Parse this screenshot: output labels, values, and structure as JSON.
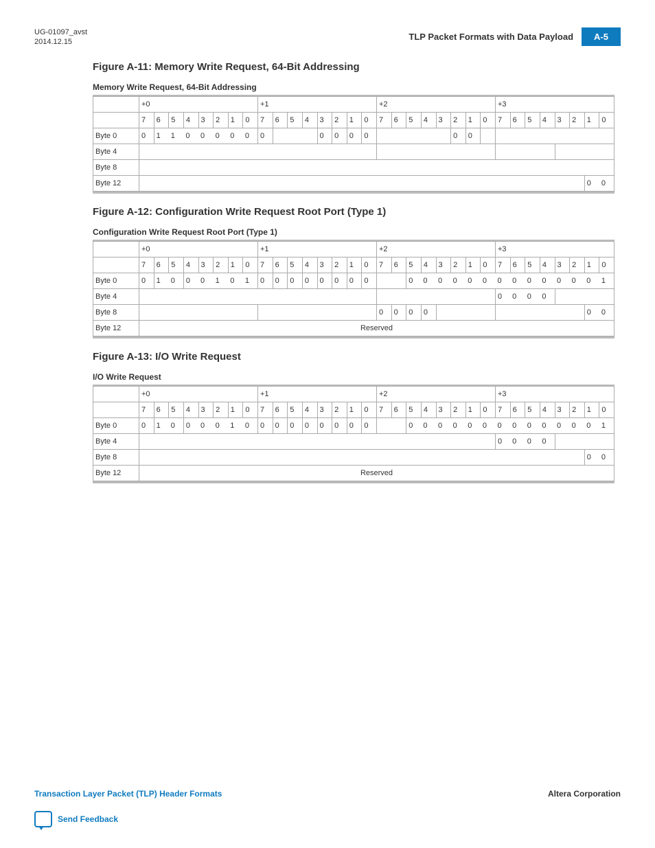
{
  "header": {
    "doc_id": "UG-01097_avst",
    "date": "2014.12.15",
    "title": "TLP Packet Formats with Data Payload",
    "page_tag": "A-5"
  },
  "figures": [
    {
      "title": "Figure A-11: Memory Write Request, 64-Bit Addressing",
      "caption": "Memory Write Request, 64-Bit Addressing"
    },
    {
      "title": "Figure A-12: Configuration Write Request Root Port (Type 1)",
      "caption": "Configuration Write Request Root Port (Type 1)"
    },
    {
      "title": "Figure A-13: I/O Write Request",
      "caption": "I/O Write Request"
    }
  ],
  "offsets": [
    "+0",
    "+1",
    "+2",
    "+3"
  ],
  "bits": [
    "7",
    "6",
    "5",
    "4",
    "3",
    "2",
    "1",
    "0"
  ],
  "row_labels": [
    "Byte 0",
    "Byte 4",
    "Byte 8",
    "Byte 12"
  ],
  "reserved": "Reserved",
  "chart_data": {
    "type": "table",
    "description": "TLP header byte layouts, 4 DW rows × 32 bit columns, grouped into +0..+3",
    "tables": [
      {
        "name": "Memory Write Request 64-Bit Addressing",
        "columns_groups": [
          "+0",
          "+1",
          "+2",
          "+3"
        ],
        "bit_labels_per_group": [
          7,
          6,
          5,
          4,
          3,
          2,
          1,
          0
        ],
        "rows": {
          "Byte 0": {
            "+0": [
              "0",
              "1",
              "1",
              "0",
              "0",
              "0",
              "0",
              "0"
            ],
            "+1": [
              "0",
              "",
              "",
              "",
              "0",
              "0",
              "0",
              "0"
            ],
            "+2": [
              "",
              "",
              "",
              "",
              "",
              "0",
              "0",
              ""
            ],
            "+3": [
              "",
              "",
              "",
              "",
              "",
              "",
              "",
              ""
            ]
          },
          "Byte 4": {
            "+0": [],
            "+1": [],
            "+2": [],
            "+3": []
          },
          "Byte 8": {
            "+0": [],
            "+1": [],
            "+2": [],
            "+3": []
          },
          "Byte 12": {
            "+0": [],
            "+1": [],
            "+2": [],
            "+3": [
              "",
              "",
              "",
              "",
              "",
              "",
              "0",
              "0"
            ]
          }
        }
      },
      {
        "name": "Configuration Write Request Root Port (Type 1)",
        "rows": {
          "Byte 0": {
            "+0": [
              "0",
              "1",
              "0",
              "0",
              "0",
              "1",
              "0",
              "1"
            ],
            "+1": [
              "0",
              "0",
              "0",
              "0",
              "0",
              "0",
              "0",
              "0"
            ],
            "+2": [
              "",
              "",
              "0",
              "0",
              "0",
              "0",
              "0",
              "0"
            ],
            "+3": [
              "0",
              "0",
              "0",
              "0",
              "0",
              "0",
              "0",
              "1"
            ]
          },
          "Byte 4": {
            "+0": [],
            "+1": [],
            "+2": [],
            "+3": [
              "0",
              "0",
              "0",
              "0",
              "",
              "",
              "",
              ""
            ]
          },
          "Byte 8": {
            "+0": [],
            "+1": [],
            "+2": [
              "0",
              "0",
              "0",
              "0",
              "",
              "",
              "",
              ""
            ],
            "+3": [
              "",
              "",
              "",
              "",
              "",
              "",
              "0",
              "0"
            ]
          },
          "Byte 12": {
            "span": "Reserved"
          }
        }
      },
      {
        "name": "I/O Write Request",
        "rows": {
          "Byte 0": {
            "+0": [
              "0",
              "1",
              "0",
              "0",
              "0",
              "0",
              "1",
              "0"
            ],
            "+1": [
              "0",
              "0",
              "0",
              "0",
              "0",
              "0",
              "0",
              "0"
            ],
            "+2": [
              "",
              "",
              "0",
              "0",
              "0",
              "0",
              "0",
              "0"
            ],
            "+3": [
              "0",
              "0",
              "0",
              "0",
              "0",
              "0",
              "0",
              "1"
            ]
          },
          "Byte 4": {
            "+0": [],
            "+1": [],
            "+2": [],
            "+3": [
              "0",
              "0",
              "0",
              "0",
              "",
              "",
              "",
              ""
            ]
          },
          "Byte 8": {
            "+0": [],
            "+1": [],
            "+2": [],
            "+3": [
              "",
              "",
              "",
              "",
              "",
              "",
              "0",
              "0"
            ]
          },
          "Byte 12": {
            "span": "Reserved"
          }
        }
      }
    ]
  },
  "footer": {
    "left_link": "Transaction Layer Packet (TLP) Header Formats",
    "right": "Altera Corporation",
    "feedback": "Send Feedback"
  }
}
